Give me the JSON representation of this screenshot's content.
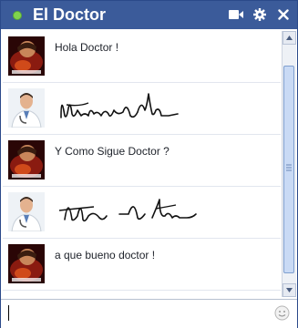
{
  "window": {
    "title": "El Doctor"
  },
  "titlebar_icons": [
    {
      "name": "video-call-icon"
    },
    {
      "name": "gear-icon"
    },
    {
      "name": "close-icon"
    }
  ],
  "messages": [
    {
      "sender": "patient",
      "text": "Hola Doctor !"
    },
    {
      "sender": "doctor",
      "text": ""
    },
    {
      "sender": "patient",
      "text": "Y Como Sigue Doctor ?"
    },
    {
      "sender": "doctor",
      "text": ""
    },
    {
      "sender": "patient",
      "text": "a que bueno doctor !"
    }
  ],
  "input": {
    "value": ""
  },
  "colors": {
    "titlebar": "#3b5b9a",
    "online": "#7fd34e"
  }
}
